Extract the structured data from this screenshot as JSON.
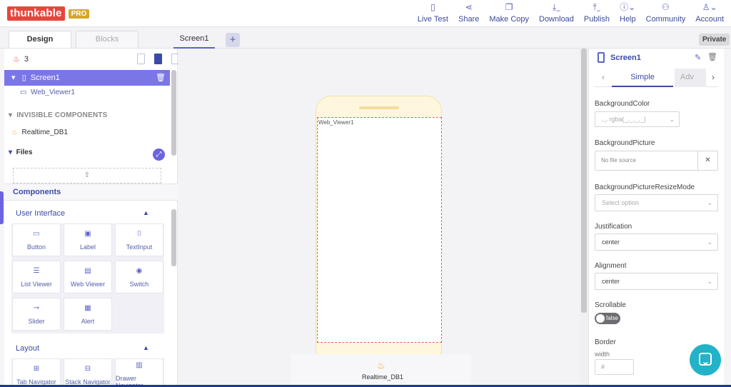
{
  "app": {
    "logo": "thunkable",
    "pro_badge": "PRO"
  },
  "top_actions": [
    {
      "label": "Live Test",
      "icon": "phone-icon"
    },
    {
      "label": "Share",
      "icon": "share-icon"
    },
    {
      "label": "Make Copy",
      "icon": "copy-icon"
    },
    {
      "label": "Download",
      "icon": "download-icon"
    },
    {
      "label": "Publish",
      "icon": "upload-icon"
    },
    {
      "label": "Help",
      "icon": "info-icon"
    },
    {
      "label": "Community",
      "icon": "community-icon"
    },
    {
      "label": "Account",
      "icon": "user-icon"
    }
  ],
  "tabs": {
    "design": "Design",
    "blocks": "Blocks",
    "screen": "Screen1",
    "add": "+",
    "privacy": "Private"
  },
  "tree": {
    "count": "3",
    "screen": "Screen1",
    "web_viewer": "Web_Viewer1",
    "invisible_header": "INVISIBLE COMPONENTS",
    "realtime": "Realtime_DB1",
    "files": "Files",
    "upload": "⇧"
  },
  "components": {
    "header": "Components",
    "ui_category": "User Interface",
    "ui_items": [
      {
        "label": "Button",
        "icon": "▭"
      },
      {
        "label": "Label",
        "icon": "▣"
      },
      {
        "label": "TextInput",
        "icon": "⌷"
      },
      {
        "label": "List Viewer",
        "icon": "☰"
      },
      {
        "label": "Web Viewer",
        "icon": "▤"
      },
      {
        "label": "Switch",
        "icon": "◉"
      },
      {
        "label": "Slider",
        "icon": "⊸"
      },
      {
        "label": "Alert",
        "icon": "▦"
      }
    ],
    "layout_category": "Layout",
    "layout_items": [
      {
        "label": "Tab Navigator",
        "icon": "⊞"
      },
      {
        "label": "Stack Navigator",
        "icon": "⊟"
      },
      {
        "label": "Drawer Navigator",
        "icon": "▥"
      }
    ]
  },
  "canvas": {
    "web_viewer_label": "Web_Viewer1",
    "realtime_label": "Realtime_DB1"
  },
  "properties": {
    "title": "Screen1",
    "tab_simple": "Simple",
    "tab_advanced": "Adv",
    "background_color_label": "BackgroundColor",
    "background_color_value": "rgba(_,_,_,_)",
    "background_picture_label": "BackgroundPicture",
    "background_picture_value": "No file source",
    "resize_mode_label": "BackgroundPictureResizeMode",
    "resize_mode_value": "Select option",
    "justification_label": "Justification",
    "justification_value": "center",
    "alignment_label": "Alignment",
    "alignment_value": "center",
    "scrollable_label": "Scrollable",
    "scrollable_value": "false",
    "border_label": "Border",
    "width_label": "width",
    "width_placeholder": "#"
  },
  "colors": {
    "accent": "#7b76e8",
    "brand": "#e8453c",
    "chat": "#22b3c9"
  }
}
